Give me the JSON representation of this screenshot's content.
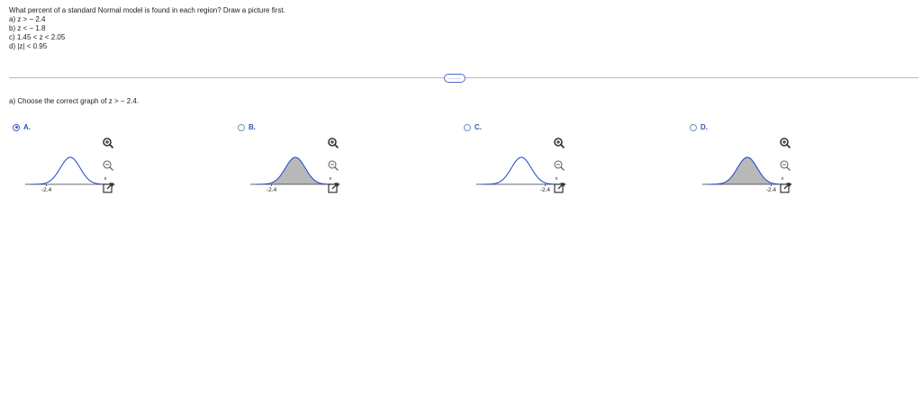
{
  "question": {
    "intro": "What percent of a standard Normal model is found in each region? Draw a picture first.",
    "parts": [
      "a) z > − 2.4",
      "b) z < − 1.8",
      "c) 1.45 < z < 2.05",
      "d) |z| < 0.95"
    ]
  },
  "more_button": {
    "label": "……"
  },
  "prompt": "a) Choose the correct graph of z > − 2.4.",
  "options": [
    {
      "letter": "A.",
      "selected": true,
      "shaded": "none",
      "cutoff": -2.4,
      "cutoff_label": "-2.4",
      "axis_label": "x"
    },
    {
      "letter": "B.",
      "selected": false,
      "shaded": "right",
      "cutoff": -2.4,
      "cutoff_label": "-2.4",
      "axis_label": "x"
    },
    {
      "letter": "C.",
      "selected": false,
      "shaded": "none",
      "cutoff": 2.4,
      "cutoff_label": "-2.4",
      "axis_label": "x"
    },
    {
      "letter": "D.",
      "selected": false,
      "shaded": "left",
      "cutoff": 2.4,
      "cutoff_label": "-2.4",
      "axis_label": "x"
    }
  ],
  "tools": [
    "zoom-in-icon",
    "zoom-out-icon",
    "open-new-window-icon"
  ],
  "colors": {
    "curve": "#1a3fd0",
    "shade": "#b8b8b8",
    "selected": "#3a64c8",
    "label": "#2c56b5"
  }
}
